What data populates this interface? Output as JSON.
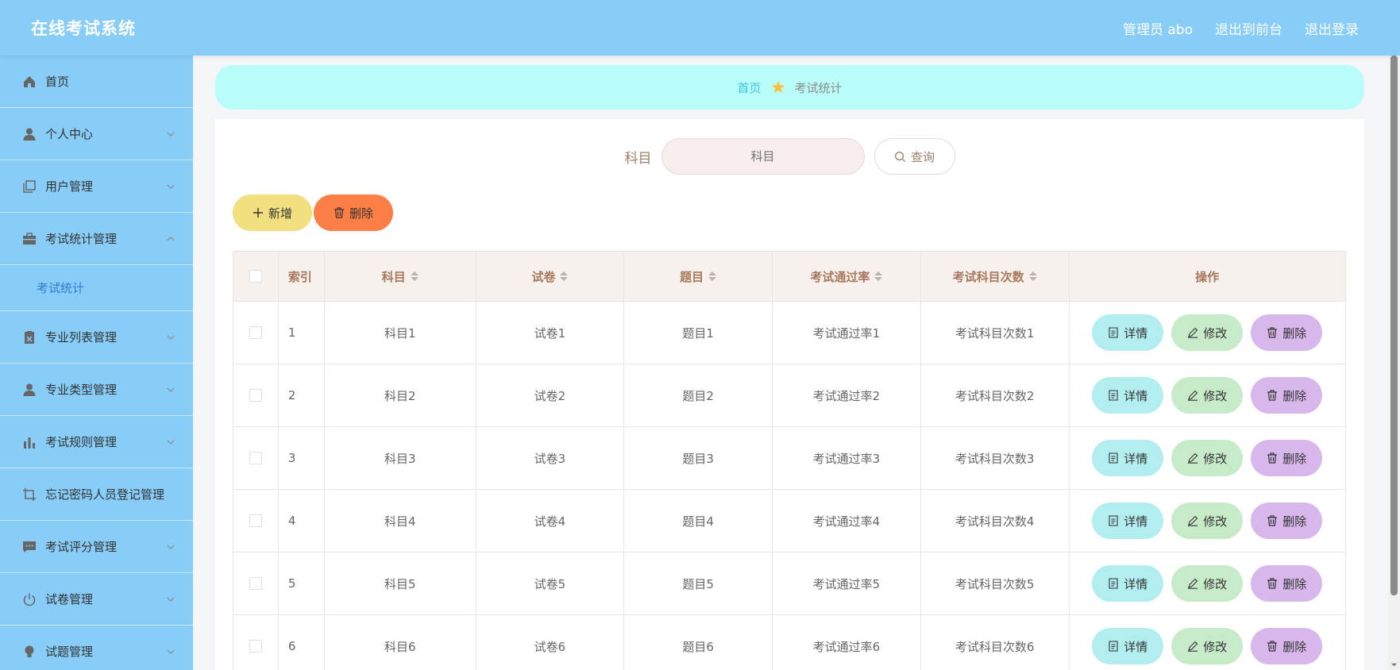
{
  "header": {
    "title": "在线考试系统",
    "links": [
      "管理员 abo",
      "退出到前台",
      "退出登录"
    ]
  },
  "sidebar": {
    "items": [
      {
        "label": "首页",
        "icon": "home-icon"
      },
      {
        "label": "个人中心",
        "icon": "user-icon",
        "expandable": true
      },
      {
        "label": "用户管理",
        "icon": "copy-icon",
        "expandable": true
      },
      {
        "label": "考试统计管理",
        "icon": "briefcase-icon",
        "expandable": true,
        "expanded": true,
        "children": [
          "考试统计"
        ]
      },
      {
        "label": "专业列表管理",
        "icon": "clipboard-icon",
        "expandable": true
      },
      {
        "label": "专业类型管理",
        "icon": "user-icon",
        "expandable": true
      },
      {
        "label": "考试规则管理",
        "icon": "bar-chart-icon",
        "expandable": true
      },
      {
        "label": "忘记密码人员登记管理",
        "icon": "crop-icon",
        "expandable": false
      },
      {
        "label": "考试评分管理",
        "icon": "chat-icon",
        "expandable": true
      },
      {
        "label": "试卷管理",
        "icon": "power-icon",
        "expandable": true
      },
      {
        "label": "试题管理",
        "icon": "bulb-icon",
        "expandable": true
      }
    ]
  },
  "breadcrumb": {
    "home": "首页",
    "current": "考试统计"
  },
  "search": {
    "label": "科目",
    "placeholder": "科目",
    "button": "查询"
  },
  "actions": {
    "add": "新增",
    "delete": "删除"
  },
  "table": {
    "columns": [
      "索引",
      "科目",
      "试卷",
      "题目",
      "考试通过率",
      "考试科目次数",
      "操作"
    ],
    "rows": [
      {
        "index": "1",
        "subject": "科目1",
        "paper": "试卷1",
        "question": "题目1",
        "rate": "考试通过率1",
        "count": "考试科目次数1"
      },
      {
        "index": "2",
        "subject": "科目2",
        "paper": "试卷2",
        "question": "题目2",
        "rate": "考试通过率2",
        "count": "考试科目次数2"
      },
      {
        "index": "3",
        "subject": "科目3",
        "paper": "试卷3",
        "question": "题目3",
        "rate": "考试通过率3",
        "count": "考试科目次数3"
      },
      {
        "index": "4",
        "subject": "科目4",
        "paper": "试卷4",
        "question": "题目4",
        "rate": "考试通过率4",
        "count": "考试科目次数4"
      },
      {
        "index": "5",
        "subject": "科目5",
        "paper": "试卷5",
        "question": "题目5",
        "rate": "考试通过率5",
        "count": "考试科目次数5"
      },
      {
        "index": "6",
        "subject": "科目6",
        "paper": "试卷6",
        "question": "题目6",
        "rate": "考试通过率6",
        "count": "考试科目次数6"
      }
    ],
    "row_actions": {
      "detail": "详情",
      "edit": "修改",
      "delete": "删除"
    }
  },
  "colors": {
    "header_bg": "#87cdf7",
    "breadcrumb_bg": "#b9fdfb",
    "add_btn": "#f2df80",
    "delete_btn": "#fe7f45",
    "detail_btn": "#b2edf0",
    "edit_btn": "#c7ebc9",
    "row_delete_btn": "#d7b7ec"
  }
}
